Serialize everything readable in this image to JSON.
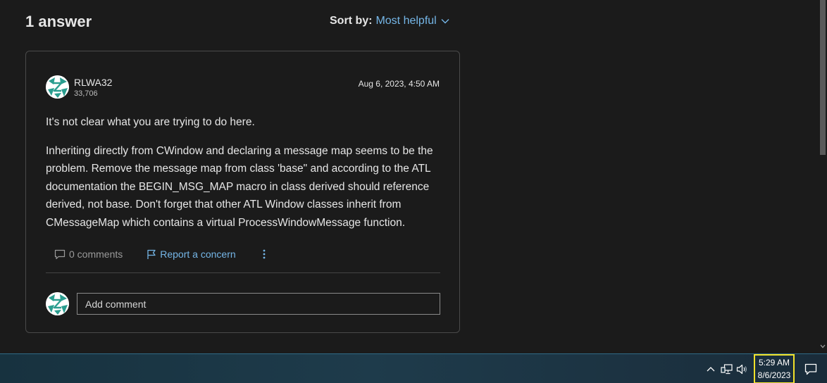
{
  "answers": {
    "title": "1 answer",
    "sort_label": "Sort by:",
    "sort_value": "Most helpful"
  },
  "answer": {
    "author_name": "RLWA32",
    "author_reputation": "33,706",
    "date": "Aug 6, 2023, 4:50 AM",
    "paragraphs": [
      "It's not clear what you are trying to do here.",
      "Inheriting directly from CWindow and declaring a message map seems to be the problem. Remove the message map from class 'base\" and according to the ATL documentation the BEGIN_MSG_MAP macro in class derived should reference derived, not base. Don't forget that other ATL Window classes inherit from CMessageMap which contains a virtual ProcessWindowMessage function."
    ],
    "comments_label": "0 comments",
    "report_label": "Report a concern",
    "add_comment_placeholder": "Add comment"
  },
  "taskbar": {
    "time": "5:29 AM",
    "date": "8/6/2023"
  },
  "icons": [
    "chevron-down-icon",
    "comment-icon",
    "flag-icon",
    "more-vertical-icon",
    "avatar-icon",
    "chevron-up-icon",
    "network-icon",
    "volume-icon",
    "notification-icon"
  ],
  "colors": {
    "background": "#1b1b1b",
    "link": "#75b6e7",
    "card_border": "#4a4a4a",
    "clock_highlight": "#f1e12a",
    "avatar_teal": "#2a9d8f"
  }
}
